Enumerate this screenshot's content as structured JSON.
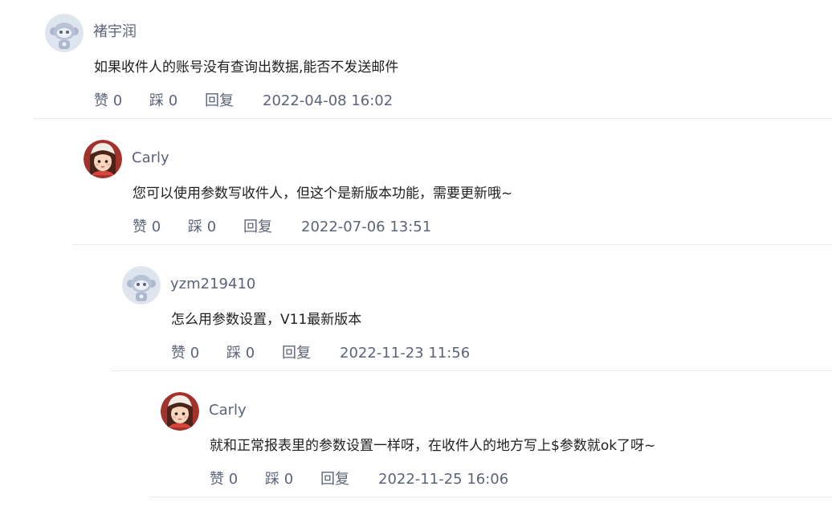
{
  "comments": [
    {
      "username": "褚宇润",
      "text": "如果收件人的账号没有查询出数据,能否不发送邮件",
      "like_label": "赞 0",
      "dislike_label": "踩 0",
      "reply_label": "回复",
      "timestamp": "2022-04-08 16:02",
      "avatar_icon": "robot-avatar-icon"
    },
    {
      "username": "Carly",
      "text": "您可以使用参数写收件人，但这个是新版本功能，需要更新哦~",
      "like_label": "赞 0",
      "dislike_label": "踩 0",
      "reply_label": "回复",
      "timestamp": "2022-07-06 13:51",
      "avatar_icon": "girl-avatar-icon"
    },
    {
      "username": "yzm219410",
      "text": "怎么用参数设置，V11最新版本",
      "like_label": "赞 0",
      "dislike_label": "踩 0",
      "reply_label": "回复",
      "timestamp": "2022-11-23 11:56",
      "avatar_icon": "robot-avatar-icon"
    },
    {
      "username": "Carly",
      "text": "就和正常报表里的参数设置一样呀，在收件人的地方写上$参数就ok了呀~",
      "like_label": "赞 0",
      "dislike_label": "踩 0",
      "reply_label": "回复",
      "timestamp": "2022-11-25 16:06",
      "avatar_icon": "girl-avatar-icon"
    }
  ],
  "colors": {
    "meta_text": "#5b6478",
    "body_text": "#1f1f1f",
    "divider": "#ebebeb",
    "robot_avatar_bg": "#dfe5ef",
    "girl_avatar_bg": "#a3322d"
  }
}
